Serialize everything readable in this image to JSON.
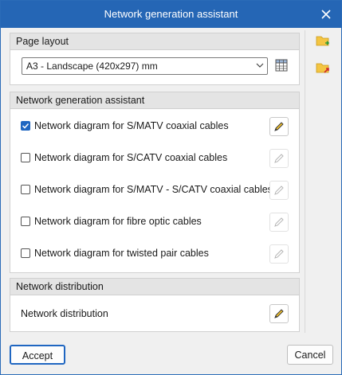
{
  "window": {
    "title": "Network generation assistant",
    "close_icon": "close-icon"
  },
  "page_layout": {
    "header": "Page layout",
    "selected_value": "A3 - Landscape (420x297) mm"
  },
  "assistant": {
    "header": "Network generation assistant",
    "items": [
      {
        "label": "Network diagram for S/MATV coaxial cables",
        "checked": true,
        "edit_enabled": true
      },
      {
        "label": "Network diagram for S/CATV coaxial cables",
        "checked": false,
        "edit_enabled": false
      },
      {
        "label": "Network diagram for S/MATV - S/CATV coaxial cables",
        "checked": false,
        "edit_enabled": false
      },
      {
        "label": "Network diagram for fibre optic cables",
        "checked": false,
        "edit_enabled": false
      },
      {
        "label": "Network diagram for twisted pair cables",
        "checked": false,
        "edit_enabled": false
      }
    ]
  },
  "distribution": {
    "header": "Network distribution",
    "label": "Network distribution"
  },
  "footer": {
    "accept_label": "Accept",
    "cancel_label": "Cancel"
  },
  "colors": {
    "titlebar": "#2566b5",
    "accent": "#1f66c1",
    "pencil_enabled": "#f2c12e"
  }
}
